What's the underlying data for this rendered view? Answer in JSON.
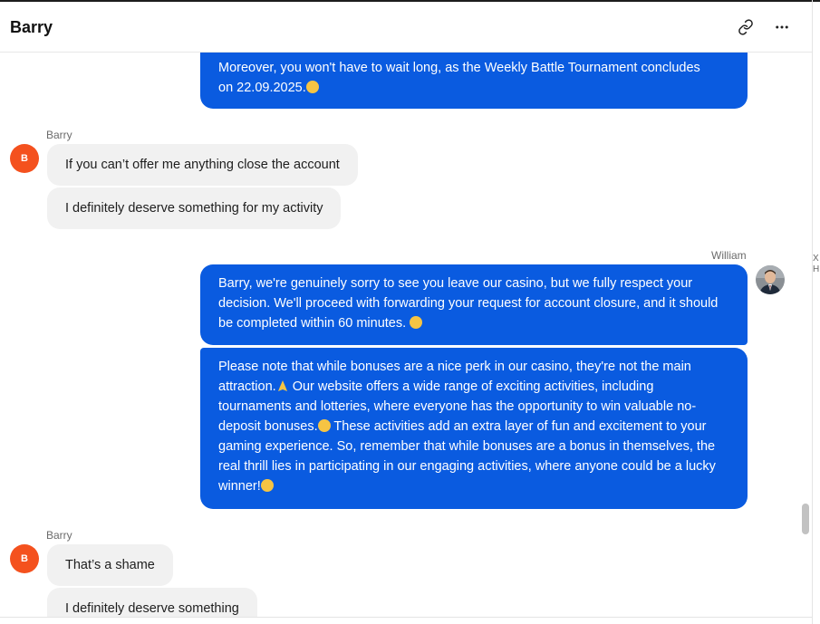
{
  "header": {
    "title": "Barry",
    "link_icon": "link-icon",
    "more_icon": "more-horizontal-icon"
  },
  "colors": {
    "outgoing_bubble": "#0a5be0",
    "incoming_bubble": "#f1f1f1",
    "avatar_barry": "#f4511e"
  },
  "messages": {
    "m1_line1": "Moreover, you won't have to wait long, as the Weekly Battle Tournament concludes",
    "m1_line2": "on 22.09.2025.",
    "group2": {
      "sender": "Barry",
      "avatar_initial": "B",
      "msg1": "If you can’t offer me anything close the account",
      "msg2": "I definitely deserve something for my activity"
    },
    "group3": {
      "sender": "William",
      "msg1": "Barry, we're genuinely sorry to see you leave our casino, but we fully respect your decision. We'll proceed with forwarding your request for account closure, and it should be completed within 60 minutes.",
      "msg2_part1": "Please note that while bonuses are a nice perk in our casino, they're not the main attraction.",
      "msg2_part2": " Our website offers a wide range of exciting activities, including tournaments and lotteries, where everyone has the opportunity to win valuable no-deposit bonuses.",
      "msg2_part3": " These activities add an extra layer of fun and excitement to your gaming experience. So, remember that while bonuses are a bonus in themselves, the real thrill lies in participating in our engaging activities, where anyone could be a lucky winner!"
    },
    "group4": {
      "sender": "Barry",
      "avatar_initial": "B",
      "msg1": "That’s a shame",
      "msg2": "I definitely deserve something"
    }
  },
  "edge_fragment": {
    "line1": "X",
    "line2": "H"
  }
}
